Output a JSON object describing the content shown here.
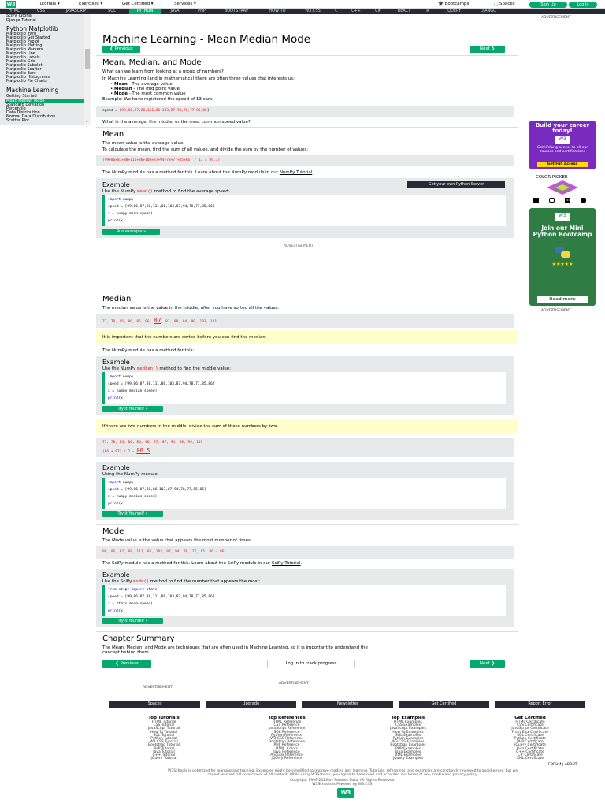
{
  "topbar": {
    "logo": "W3",
    "menus": [
      "Tutorials ▾",
      "Exercises ▾",
      "Get Certified ▾",
      "Services ▾"
    ],
    "bootcamps": "Bootcamps",
    "spaces": "Spaces",
    "signup": "Sign Up",
    "login": "Log in"
  },
  "subnav": [
    "HTML",
    "CSS",
    "JAVASCRIPT",
    "SQL",
    "PYTHON",
    "JAVA",
    "PHP",
    "BOOTSTRAP",
    "HOW TO",
    "W3.CSS",
    "C",
    "C++",
    "C#",
    "REACT",
    "R",
    "JQUERY",
    "DJANGO"
  ],
  "sidebar": {
    "top_items": [
      "SciPy Tutorial",
      "Django Tutorial"
    ],
    "heading1": "Python Matplotlib",
    "items1": [
      "Matplotlib Intro",
      "Matplotlib Get Started",
      "Matplotlib Pyplot",
      "Matplotlib Plotting",
      "Matplotlib Markers",
      "Matplotlib Line",
      "Matplotlib Labels",
      "Matplotlib Grid",
      "Matplotlib Subplot",
      "Matplotlib Scatter",
      "Matplotlib Bars",
      "Matplotlib Histograms",
      "Matplotlib Pie Charts"
    ],
    "heading2": "Machine Learning",
    "items2": [
      "Getting Started",
      "Mean Median Mode",
      "Standard Deviation",
      "Percentile",
      "Data Distribution",
      "Normal Data Distribution",
      "Scatter Plot"
    ]
  },
  "main": {
    "title": "Machine Learning - Mean Median Mode",
    "prev": "❮ Previous",
    "next": "Next ❯",
    "sec1_title": "Mean, Median, and Mode",
    "sec1_p1": "What can we learn from looking at a group of numbers?",
    "sec1_p2": "In Machine Learning (and in mathematics) there are often three values that interests us:",
    "bullets": [
      {
        "b": "Mean",
        "t": " - The average value"
      },
      {
        "b": "Median",
        "t": " - The mid point value"
      },
      {
        "b": "Mode",
        "t": " - The most common value"
      }
    ],
    "sec1_p3": "Example: We have registered the speed of 13 cars:",
    "speed_label": "speed = [",
    "speed_values": "99,86,87,88,111,86,103,87,94,78,77,85,86",
    "speed_end": "]",
    "sec1_p4": "What is the average, the middle, or the most common speed value?",
    "mean_title": "Mean",
    "mean_p1": "The mean value is the average value.",
    "mean_p2": "To calculate the mean, find the sum of all values, and divide the sum by the number of values:",
    "mean_calc": "(99+86+87+88+111+86+103+87+94+78+77+85+86) / 13 = 89.77",
    "mean_p3": "The NumPy module has a method for this. Learn about the NumPy module in our ",
    "numpy_link": "NumPy Tutorial",
    "example": "Example",
    "mean_ex_desc_a": "Use the NumPy ",
    "mean_ex_fn": "mean()",
    "mean_ex_desc_b": " method to find the average speed:",
    "get_server": "Get your own Python Server",
    "import_kw": "import",
    "numpy_mod": " numpy",
    "speed_line": "speed = [99,86,87,88,111,86,103,87,94,78,77,85,86]",
    "mean_line": "x = numpy.mean(speed)",
    "print_kw": "print",
    "print_arg": "(x)",
    "run_example": "Run example »",
    "advertisement": "ADVERTISEMENT",
    "median_title": "Median",
    "median_p1": "The median value is the value in the middle, after you have sorted all the values:",
    "sorted_a": "77, 78, 85, 86, 86, 86, ",
    "sorted_mid": "87",
    "sorted_b": ", 87, 88, 94, 99, 103, 111",
    "note1": "It is important that the numbers are sorted before you can find the median.",
    "median_p2": "The NumPy module has a method for this:",
    "median_ex_desc_a": "Use the NumPy ",
    "median_ex_fn": "median()",
    "median_ex_desc_b": " method to find the middle value:",
    "median_line": "x = numpy.median(speed)",
    "try_it": "Try it Yourself »",
    "note2": "If there are two numbers in the middle, divide the sum of those numbers by two.",
    "even_a": "77, 78, 85, 86, 86, ",
    "even_86": "86",
    "even_sep": ", ",
    "even_87": "87",
    "even_b": ", 87, 94, 98, 99, 103",
    "even_calc": "(86 + 87) / 2 = ",
    "even_result": "86.5",
    "ex2_desc": "Using the NumPy module:",
    "speed_line2": "speed = [99,86,87,88,86,103,87,94,78,77,85,86]",
    "mode_title": "Mode",
    "mode_p1": "The Mode value is the value that appears the most number of times:",
    "mode_seq": "99, 86, 87, 88, 111, 86, 103, 87, 94, 78, 77, 85, 86 = 86",
    "mode_p2": "The SciPy module has a method for this. Learn about the SciPy module in our ",
    "scipy_link": "SciPy Tutorial",
    "mode_ex_desc_a": "Use the SciPy ",
    "mode_ex_fn": "mode()",
    "mode_ex_desc_b": " method to find the number that appears the most:",
    "from_kw": "from",
    "scipy_mod": " scipy ",
    "stats_mod": " stats",
    "mode_line": "x = stats.mode(speed)",
    "summary_title": "Chapter Summary",
    "summary_p1": "The Mean, Median, and Mode are techniques that are often used in Machine Learning, so it is important to understand the",
    "summary_p2": "concept behind them.",
    "login_track": "Log in to track progress"
  },
  "right": {
    "advertisement": "ADVERTISEMENT",
    "ad1_title": "Build your career today!",
    "ad1_text": "Get lifelong access to all our courses and certifications",
    "ad1_btn": "Get Full Access",
    "color_picker": "COLOR PICKER",
    "ad2_title": "Join our Mini Python Bootcamp",
    "ad2_btn": "Read more"
  },
  "footer": {
    "advertisement": "ADVERTISEMENT",
    "buttons": [
      "Spaces",
      "Upgrade",
      "Newsletter",
      "Get Certified",
      "Report Error"
    ],
    "cols": [
      {
        "title": "Top Tutorials",
        "links": [
          "HTML Tutorial",
          "CSS Tutorial",
          "JavaScript Tutorial",
          "How To Tutorial",
          "SQL Tutorial",
          "Python Tutorial",
          "W3.CSS Tutorial",
          "Bootstrap Tutorial",
          "PHP Tutorial",
          "Java Tutorial",
          "C++ Tutorial",
          "jQuery Tutorial"
        ]
      },
      {
        "title": "Top References",
        "links": [
          "HTML Reference",
          "CSS Reference",
          "JavaScript Reference",
          "SQL Reference",
          "Python Reference",
          "W3.CSS Reference",
          "Bootstrap Reference",
          "PHP Reference",
          "HTML Colors",
          "Java Reference",
          "Angular Reference",
          "jQuery Reference"
        ]
      },
      {
        "title": "Top Examples",
        "links": [
          "HTML Examples",
          "CSS Examples",
          "JavaScript Examples",
          "How To Examples",
          "SQL Examples",
          "Python Examples",
          "W3.CSS Examples",
          "Bootstrap Examples",
          "PHP Examples",
          "Java Examples",
          "XML Examples",
          "jQuery Examples"
        ]
      },
      {
        "title": "Get Certified",
        "links": [
          "HTML Certificate",
          "CSS Certificate",
          "JavaScript Certificate",
          "Front End Certificate",
          "SQL Certificate",
          "Python Certificate",
          "PHP Certificate",
          "jQuery Certificate",
          "Java Certificate",
          "C++ Certificate",
          "C# Certificate",
          "XML Certificate"
        ]
      }
    ],
    "forum": "FORUM | ABOUT",
    "disclaimer1": "W3Schools is optimized for learning and training. Examples might be simplified to improve reading and learning. Tutorials, references, and examples are constantly reviewed to avoid errors, but we",
    "disclaimer2": "cannot warrant full correctness of all content. While using W3Schools, you agree to have read and accepted our terms of use, cookie and privacy policy.",
    "copyright": "Copyright 1999-2023 by Refsnes Data. All Rights Reserved.",
    "powered": "W3Schools is Powered by W3.CSS."
  }
}
